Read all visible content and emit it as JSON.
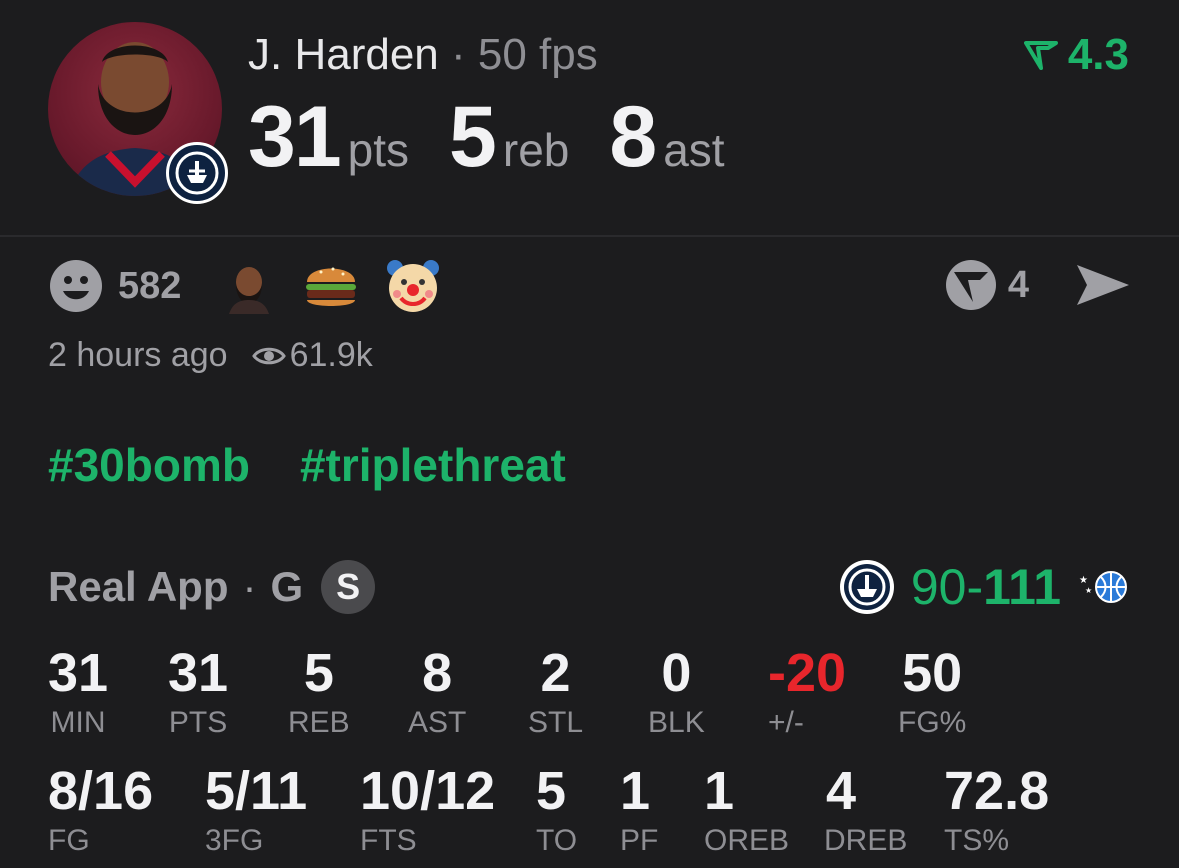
{
  "player": {
    "name": "J. Harden",
    "separator": "·",
    "fps": "50 fps",
    "rating": "4.3",
    "stats": [
      {
        "value": "31",
        "unit": "pts"
      },
      {
        "value": "5",
        "unit": "reb"
      },
      {
        "value": "8",
        "unit": "ast"
      }
    ]
  },
  "reactions": {
    "count": "582",
    "emojis": [
      "harden-face-emoji",
      "burger-emoji",
      "clown-emoji"
    ],
    "comments": "4"
  },
  "meta": {
    "time": "2 hours ago",
    "views": "61.9k"
  },
  "tags": [
    "#30bomb",
    "#triplethreat"
  ],
  "game": {
    "source": "Real App",
    "sep": "·",
    "position": "G",
    "badge": "S",
    "score_left": "90-",
    "score_right": "111"
  },
  "boxscore_row1": [
    {
      "value": "31",
      "label": "MIN"
    },
    {
      "value": "31",
      "label": "PTS"
    },
    {
      "value": "5",
      "label": "REB"
    },
    {
      "value": "8",
      "label": "AST"
    },
    {
      "value": "2",
      "label": "STL"
    },
    {
      "value": "0",
      "label": "BLK"
    },
    {
      "value": "-20",
      "label": "+/-"
    },
    {
      "value": "50",
      "label": "FG%"
    }
  ],
  "boxscore_row2": [
    {
      "value": "8/16",
      "label": "FG"
    },
    {
      "value": "5/11",
      "label": "3FG"
    },
    {
      "value": "10/12",
      "label": "FTS"
    },
    {
      "value": "5",
      "label": "TO"
    },
    {
      "value": "1",
      "label": "PF"
    },
    {
      "value": "1",
      "label": "OREB"
    },
    {
      "value": "4",
      "label": "DREB"
    },
    {
      "value": "72.8",
      "label": "TS%"
    }
  ],
  "colors": {
    "accent": "#1db36a",
    "negative": "#e8262c",
    "background": "#1c1c1e"
  }
}
